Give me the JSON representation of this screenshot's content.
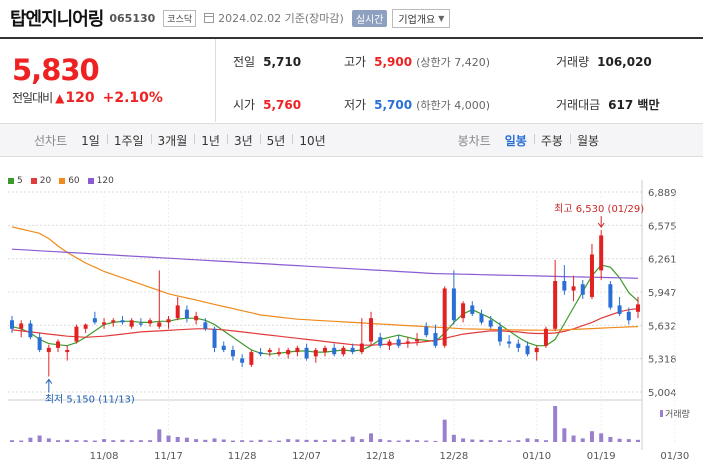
{
  "header": {
    "name": "탑엔지니어링",
    "code": "065130",
    "market": "코스닥",
    "date_text": "2024.02.02  기준(장마감)",
    "live_label": "실시간",
    "corp_label": "기업개요"
  },
  "price": {
    "current": "5,830",
    "change_label": "전일대비",
    "change_value": "120",
    "change_pct": "+2.10%"
  },
  "stats": {
    "prev_label": "전일",
    "prev_value": "5,710",
    "high_label": "고가",
    "high_value": "5,900",
    "high_limit": "(상한가 7,420)",
    "volume_label": "거래량",
    "volume_value": "106,020",
    "open_label": "시가",
    "open_value": "5,760",
    "low_label": "저가",
    "low_value": "5,700",
    "low_limit": "(하한가 4,000)",
    "amount_label": "거래대금",
    "amount_value": "617 백만"
  },
  "tabs": {
    "line_label": "선차트",
    "periods": [
      "1일",
      "1주일",
      "3개월",
      "1년",
      "3년",
      "5년",
      "10년"
    ],
    "candle_label": "봉차트",
    "candle_periods": [
      "일봉",
      "주봉",
      "월봉"
    ],
    "active_candle": "일봉"
  },
  "legend": [
    {
      "label": "5",
      "color": "#3c9a2b"
    },
    {
      "label": "20",
      "color": "#e23b3b"
    },
    {
      "label": "60",
      "color": "#f08a1c"
    },
    {
      "label": "120",
      "color": "#8a5bd1"
    }
  ],
  "colors": {
    "up": "#e22222",
    "down": "#2a6fd6",
    "volume": "#9a7fcf",
    "grid": "#dddddd"
  },
  "chart_data": {
    "type": "candlestick",
    "y_ticks": [
      "6,889",
      "6,575",
      "6,261",
      "5,947",
      "5,632",
      "5,318",
      "5,004"
    ],
    "ylim": [
      5004,
      6889
    ],
    "x_labels": [
      "11/08",
      "11/17",
      "11/28",
      "12/07",
      "12/18",
      "12/28",
      "01/10",
      "01/19",
      "01/30"
    ],
    "max_annotation": "최고 6,530 (01/29)",
    "min_annotation": "최저 5,150 (11/13)",
    "volume_label": "거래량",
    "candles": [
      {
        "o": 5680,
        "h": 5720,
        "l": 5560,
        "c": 5600
      },
      {
        "o": 5600,
        "h": 5680,
        "l": 5520,
        "c": 5650
      },
      {
        "o": 5650,
        "h": 5680,
        "l": 5500,
        "c": 5520
      },
      {
        "o": 5520,
        "h": 5560,
        "l": 5380,
        "c": 5400
      },
      {
        "o": 5380,
        "h": 5450,
        "l": 5150,
        "c": 5420
      },
      {
        "o": 5420,
        "h": 5500,
        "l": 5380,
        "c": 5480
      },
      {
        "o": 5380,
        "h": 5440,
        "l": 5300,
        "c": 5400
      },
      {
        "o": 5480,
        "h": 5640,
        "l": 5460,
        "c": 5620
      },
      {
        "o": 5600,
        "h": 5650,
        "l": 5560,
        "c": 5640
      },
      {
        "o": 5700,
        "h": 5760,
        "l": 5640,
        "c": 5660
      },
      {
        "o": 5640,
        "h": 5700,
        "l": 5600,
        "c": 5660
      },
      {
        "o": 5660,
        "h": 5700,
        "l": 5620,
        "c": 5680
      },
      {
        "o": 5680,
        "h": 5720,
        "l": 5640,
        "c": 5660
      },
      {
        "o": 5620,
        "h": 5700,
        "l": 5600,
        "c": 5680
      },
      {
        "o": 5650,
        "h": 5700,
        "l": 5620,
        "c": 5640
      },
      {
        "o": 5650,
        "h": 5700,
        "l": 5620,
        "c": 5680
      },
      {
        "o": 5620,
        "h": 6150,
        "l": 5600,
        "c": 5660
      },
      {
        "o": 5660,
        "h": 5720,
        "l": 5600,
        "c": 5690
      },
      {
        "o": 5700,
        "h": 5900,
        "l": 5680,
        "c": 5820
      },
      {
        "o": 5780,
        "h": 5820,
        "l": 5660,
        "c": 5700
      },
      {
        "o": 5680,
        "h": 5760,
        "l": 5640,
        "c": 5720
      },
      {
        "o": 5660,
        "h": 5700,
        "l": 5580,
        "c": 5600
      },
      {
        "o": 5600,
        "h": 5620,
        "l": 5380,
        "c": 5420
      },
      {
        "o": 5440,
        "h": 5480,
        "l": 5380,
        "c": 5400
      },
      {
        "o": 5400,
        "h": 5440,
        "l": 5300,
        "c": 5340
      },
      {
        "o": 5320,
        "h": 5360,
        "l": 5240,
        "c": 5280
      },
      {
        "o": 5260,
        "h": 5400,
        "l": 5240,
        "c": 5380
      },
      {
        "o": 5380,
        "h": 5420,
        "l": 5340,
        "c": 5360
      },
      {
        "o": 5380,
        "h": 5420,
        "l": 5340,
        "c": 5400
      },
      {
        "o": 5360,
        "h": 5420,
        "l": 5340,
        "c": 5380
      },
      {
        "o": 5360,
        "h": 5420,
        "l": 5320,
        "c": 5400
      },
      {
        "o": 5380,
        "h": 5440,
        "l": 5340,
        "c": 5420
      },
      {
        "o": 5420,
        "h": 5460,
        "l": 5300,
        "c": 5320
      },
      {
        "o": 5340,
        "h": 5420,
        "l": 5280,
        "c": 5400
      },
      {
        "o": 5380,
        "h": 5440,
        "l": 5340,
        "c": 5420
      },
      {
        "o": 5420,
        "h": 5460,
        "l": 5340,
        "c": 5360
      },
      {
        "o": 5360,
        "h": 5440,
        "l": 5340,
        "c": 5420
      },
      {
        "o": 5420,
        "h": 5460,
        "l": 5360,
        "c": 5380
      },
      {
        "o": 5380,
        "h": 5700,
        "l": 5360,
        "c": 5460
      },
      {
        "o": 5480,
        "h": 5760,
        "l": 5440,
        "c": 5700
      },
      {
        "o": 5520,
        "h": 5560,
        "l": 5420,
        "c": 5440
      },
      {
        "o": 5440,
        "h": 5500,
        "l": 5400,
        "c": 5480
      },
      {
        "o": 5500,
        "h": 5540,
        "l": 5420,
        "c": 5440
      },
      {
        "o": 5460,
        "h": 5520,
        "l": 5420,
        "c": 5480
      },
      {
        "o": 5480,
        "h": 5560,
        "l": 5440,
        "c": 5500
      },
      {
        "o": 5620,
        "h": 5660,
        "l": 5520,
        "c": 5540
      },
      {
        "o": 5560,
        "h": 5640,
        "l": 5420,
        "c": 5440
      },
      {
        "o": 5440,
        "h": 6000,
        "l": 5420,
        "c": 5980
      },
      {
        "o": 5980,
        "h": 6150,
        "l": 5640,
        "c": 5680
      },
      {
        "o": 5700,
        "h": 5860,
        "l": 5660,
        "c": 5840
      },
      {
        "o": 5820,
        "h": 5860,
        "l": 5720,
        "c": 5740
      },
      {
        "o": 5740,
        "h": 5780,
        "l": 5640,
        "c": 5660
      },
      {
        "o": 5680,
        "h": 5720,
        "l": 5600,
        "c": 5620
      },
      {
        "o": 5620,
        "h": 5660,
        "l": 5440,
        "c": 5480
      },
      {
        "o": 5480,
        "h": 5540,
        "l": 5420,
        "c": 5460
      },
      {
        "o": 5460,
        "h": 5500,
        "l": 5380,
        "c": 5420
      },
      {
        "o": 5440,
        "h": 5480,
        "l": 5340,
        "c": 5360
      },
      {
        "o": 5380,
        "h": 5440,
        "l": 5300,
        "c": 5420
      },
      {
        "o": 5440,
        "h": 5620,
        "l": 5420,
        "c": 5600
      },
      {
        "o": 5600,
        "h": 6250,
        "l": 5580,
        "c": 6050
      },
      {
        "o": 6050,
        "h": 6200,
        "l": 5920,
        "c": 5960
      },
      {
        "o": 5960,
        "h": 6100,
        "l": 5860,
        "c": 6000
      },
      {
        "o": 6020,
        "h": 6060,
        "l": 5880,
        "c": 5920
      },
      {
        "o": 5900,
        "h": 6400,
        "l": 5880,
        "c": 6300
      },
      {
        "o": 6150,
        "h": 6530,
        "l": 6060,
        "c": 6480
      },
      {
        "o": 6020,
        "h": 6050,
        "l": 5780,
        "c": 5800
      },
      {
        "o": 5820,
        "h": 5900,
        "l": 5720,
        "c": 5740
      },
      {
        "o": 5760,
        "h": 5800,
        "l": 5640,
        "c": 5680
      },
      {
        "o": 5760,
        "h": 5900,
        "l": 5700,
        "c": 5830
      }
    ],
    "volumes": [
      0.05,
      0.04,
      0.12,
      0.18,
      0.1,
      0.05,
      0.06,
      0.05,
      0.05,
      0.04,
      0.08,
      0.05,
      0.06,
      0.05,
      0.05,
      0.05,
      0.35,
      0.18,
      0.14,
      0.12,
      0.08,
      0.06,
      0.1,
      0.07,
      0.04,
      0.05,
      0.04,
      0.06,
      0.04,
      0.04,
      0.08,
      0.07,
      0.06,
      0.06,
      0.05,
      0.07,
      0.06,
      0.15,
      0.08,
      0.24,
      0.08,
      0.05,
      0.04,
      0.06,
      0.05,
      0.04,
      0.03,
      0.62,
      0.2,
      0.1,
      0.07,
      0.06,
      0.05,
      0.05,
      0.04,
      0.05,
      0.1,
      0.08,
      0.05,
      1.0,
      0.38,
      0.18,
      0.1,
      0.3,
      0.24,
      0.14,
      0.09,
      0.08,
      0.06
    ],
    "ma_series": [
      {
        "name": "5",
        "values": [
          5620,
          5600,
          5560,
          5500,
          5460,
          5450,
          5440,
          5470,
          5520,
          5580,
          5640,
          5660,
          5670,
          5670,
          5660,
          5660,
          5670,
          5670,
          5690,
          5700,
          5700,
          5680,
          5640,
          5580,
          5520,
          5460,
          5400,
          5370,
          5360,
          5370,
          5380,
          5390,
          5390,
          5380,
          5380,
          5390,
          5400,
          5390,
          5400,
          5440,
          5500,
          5520,
          5540,
          5520,
          5500,
          5490,
          5480,
          5560,
          5660,
          5740,
          5780,
          5740,
          5700,
          5640,
          5580,
          5520,
          5470,
          5440,
          5440,
          5500,
          5650,
          5800,
          5950,
          6100,
          6200,
          6180,
          6080,
          5940,
          5860
        ]
      },
      {
        "name": "20",
        "values": [
          5590,
          5580,
          5570,
          5560,
          5550,
          5540,
          5530,
          5525,
          5520,
          5525,
          5530,
          5540,
          5550,
          5560,
          5570,
          5575,
          5580,
          5585,
          5590,
          5595,
          5600,
          5600,
          5595,
          5590,
          5580,
          5570,
          5560,
          5550,
          5540,
          5530,
          5520,
          5510,
          5500,
          5490,
          5480,
          5470,
          5460,
          5450,
          5445,
          5445,
          5450,
          5455,
          5460,
          5465,
          5470,
          5480,
          5490,
          5510,
          5530,
          5550,
          5560,
          5570,
          5580,
          5580,
          5575,
          5570,
          5560,
          5555,
          5555,
          5560,
          5575,
          5600,
          5630,
          5660,
          5700,
          5730,
          5760,
          5780,
          5790
        ]
      },
      {
        "name": "60",
        "values": [
          6560,
          6540,
          6520,
          6500,
          6450,
          6380,
          6320,
          6270,
          6220,
          6180,
          6140,
          6110,
          6080,
          6050,
          6020,
          5990,
          5960,
          5930,
          5910,
          5890,
          5870,
          5850,
          5830,
          5810,
          5790,
          5770,
          5750,
          5730,
          5720,
          5710,
          5700,
          5690,
          5685,
          5680,
          5675,
          5670,
          5665,
          5660,
          5655,
          5650,
          5645,
          5640,
          5635,
          5630,
          5625,
          5620,
          5615,
          5610,
          5605,
          5600,
          5598,
          5596,
          5594,
          5592,
          5590,
          5588,
          5587,
          5586,
          5586,
          5587,
          5590,
          5594,
          5598,
          5602,
          5606,
          5610,
          5614,
          5618,
          5620
        ]
      },
      {
        "name": "120",
        "values": [
          6350,
          6345,
          6340,
          6335,
          6330,
          6325,
          6320,
          6315,
          6310,
          6305,
          6300,
          6295,
          6290,
          6285,
          6280,
          6275,
          6270,
          6265,
          6260,
          6255,
          6250,
          6245,
          6240,
          6235,
          6230,
          6225,
          6220,
          6215,
          6210,
          6205,
          6200,
          6195,
          6190,
          6185,
          6180,
          6175,
          6170,
          6165,
          6160,
          6155,
          6150,
          6145,
          6140,
          6135,
          6130,
          6125,
          6120,
          6118,
          6116,
          6114,
          6112,
          6110,
          6108,
          6106,
          6104,
          6102,
          6100,
          6098,
          6096,
          6094,
          6092,
          6090,
          6088,
          6086,
          6084,
          6082,
          6080,
          6078,
          6076
        ]
      }
    ]
  }
}
